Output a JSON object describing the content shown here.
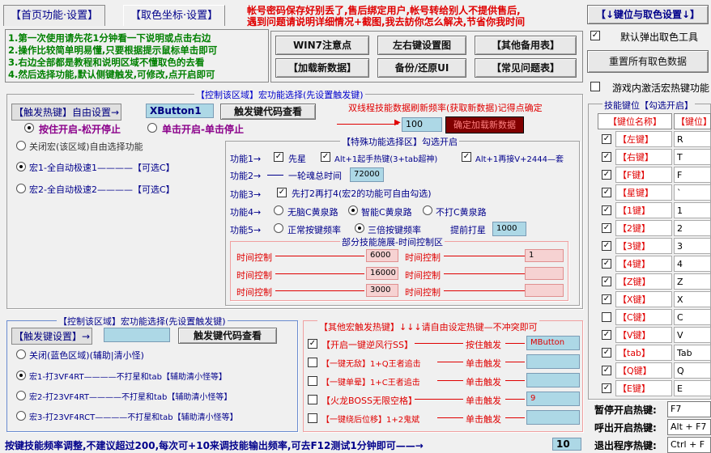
{
  "tabs": {
    "home": "【首页功能·设置】",
    "color": "【取色坐标·设置】"
  },
  "notice": {
    "line1": "帐号密码保存好别丢了,售后绑定用户,帐号转给别人不提供售后,",
    "line2": "遇到问题请说明详细情况+截图,我去訪你怎么解决,节省你我时间"
  },
  "instructions": [
    "1.第一次使用请先花1分钟看一下说明或点击右边",
    "2.操作比较简单明易懂,只要根据提示鼠标单击即可",
    "3.右边全部都是教程和说明区域不懂取色的去看",
    "4.然后选择功能,默认侧键触发,可修改,点开启即可"
  ],
  "top_buttons": [
    "WIN7注意点",
    "左右键设置图",
    "【其他备用表】",
    "【加载新数据】",
    "备份/还原UI",
    "【常见问题表】"
  ],
  "right_panel": {
    "keybind_button": "【↓键位与取色设置↓】",
    "popup_checkbox_label": "默认弹出取色工具",
    "reset_button": "重置所有取色数据",
    "ingame_checkbox_label": "游戏内激活宏热键功能"
  },
  "control_area1": {
    "title": "【控制该区域】宏功能选择(先设置触发键)",
    "hotkey_label": "【触发热键】自由设置→",
    "hotkey_value": "XButton1",
    "code_button": "触发键代码查看",
    "mode_hold": "按住开启-松开停止",
    "mode_toggle": "单击开启-单击停止",
    "refresh_label": "双线程技能数据刷新频率(获取新数据)记得点确定",
    "refresh_value": "100",
    "load_button": "确定加载新数据",
    "options": [
      {
        "label": "关闭宏(该区域)自由选择功能",
        "selected": false
      },
      {
        "label": "宏1-全自动极速1————【可选C】",
        "selected": true
      },
      {
        "label": "宏2-全自动极速2————【可选C】",
        "selected": false
      }
    ]
  },
  "special": {
    "title": "【特殊功能选择区】勾选开启",
    "f1_label": "功能1→",
    "f1_opt1": "先星",
    "f1_opt2": "Alt+1起手热键(3+tab超神)",
    "f1_opt3": "Alt+1再接V+2444—套",
    "f2_label": "功能2→",
    "f2_text": "一轮魂总时间",
    "f2_value": "72000",
    "f3_label": "功能3→",
    "f3_text": "先打2再打4(宏2的功能可自由勾选)",
    "f4_label": "功能4→",
    "f4_opts": [
      "无脑C黄泉路",
      "智能C黄泉路",
      "不打C黄泉路"
    ],
    "f5_label": "功能5→",
    "f5_opts": [
      "正常按键频率",
      "三倍按键频率"
    ],
    "f5_text": "提前打星",
    "f5_value": "1000",
    "timing_title": "部分技能施展-时间控制区",
    "timing_label": "时间控制",
    "timing_left": [
      "6000",
      "16000",
      "3000"
    ],
    "timing_right": [
      "1",
      "",
      ""
    ]
  },
  "control_area2": {
    "title": "【控制该区域】宏功能选择(先设置触发键)",
    "hotkey_label": "【触发键设置】→",
    "hotkey_value": "",
    "code_button": "触发键代码查看",
    "options": [
      {
        "label": "关闭(蓝色区域)(辅助|清小怪)",
        "selected": false
      },
      {
        "label": "宏1-打3VF4RT————不打星和tab【辅助清小怪等】",
        "selected": true
      },
      {
        "label": "宏2-打23VF4RT————不打星和tab【辅助清小怪等】",
        "selected": false
      },
      {
        "label": "宏3-打23VF4RCT————不打星和tab【辅助清小怪等】",
        "selected": false
      }
    ]
  },
  "other_hotkeys": {
    "title": "【其他宏触发热键】↓↓↓请自由设定热键—不冲突即可",
    "rows": [
      {
        "name": "【开启一键逆风行SS】",
        "action": "按住触发",
        "value": "MButton",
        "checked": true
      },
      {
        "name": "【一键无敌】1+Q王者追击",
        "action": "单击触发",
        "value": "",
        "checked": false
      },
      {
        "name": "【一键单晕】1+C王者追击",
        "action": "单击触发",
        "value": "",
        "checked": false
      },
      {
        "name": "【火龙BOSS无限空格】",
        "action": "单击触发",
        "value": "9",
        "checked": false
      },
      {
        "name": "【一键绕后位移】1+2鬼斌",
        "action": "单击触发",
        "value": "",
        "checked": false
      }
    ]
  },
  "keybinds": {
    "title": "技能键位【勾选开启】",
    "col1": "【键位名称】",
    "col2": "【键位】",
    "rows": [
      {
        "name": "【左键】",
        "value": "R",
        "checked": true
      },
      {
        "name": "【右键】",
        "value": "T",
        "checked": true
      },
      {
        "name": "【F键】",
        "value": "F",
        "checked": true
      },
      {
        "name": "【星键】",
        "value": "`",
        "checked": true
      },
      {
        "name": "【1键】",
        "value": "1",
        "checked": true
      },
      {
        "name": "【2键】",
        "value": "2",
        "checked": true
      },
      {
        "name": "【3键】",
        "value": "3",
        "checked": true
      },
      {
        "name": "【4键】",
        "value": "4",
        "checked": true
      },
      {
        "name": "【Z键】",
        "value": "Z",
        "checked": true
      },
      {
        "name": "【X键】",
        "value": "X",
        "checked": true
      },
      {
        "name": "【C键】",
        "value": "C",
        "checked": false
      },
      {
        "name": "【V键】",
        "value": "V",
        "checked": true
      },
      {
        "name": "【tab】",
        "value": "Tab",
        "checked": true
      },
      {
        "name": "【Q键】",
        "value": "Q",
        "checked": true
      },
      {
        "name": "【E键】",
        "value": "E",
        "checked": true
      }
    ],
    "pause_label": "暂停开启热键:",
    "pause_value": "F7",
    "exit_label": "呼出开启热键:",
    "exit_value": "Alt + F7",
    "quit_label": "退出程序热键:",
    "quit_value": "Ctrl + F"
  },
  "footer": {
    "text": "按键技能频率调整,不建议超过200,每次可+10来调技能输出频率,可去F12测试1分钟即可——→",
    "value": "10"
  }
}
